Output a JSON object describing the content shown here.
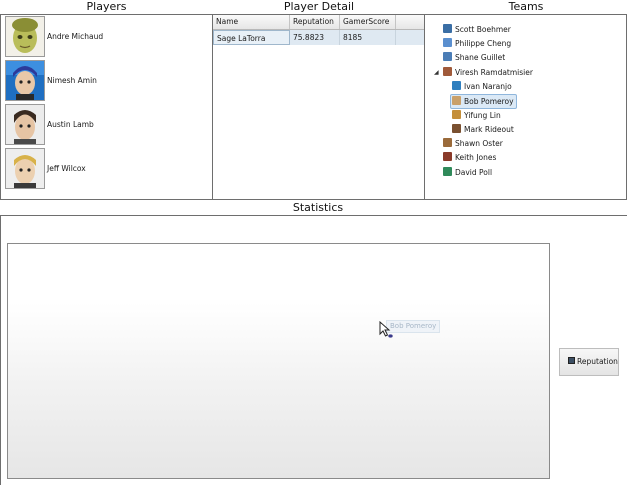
{
  "headers": {
    "players": "Players",
    "player_detail": "Player Detail",
    "teams": "Teams",
    "statistics": "Statistics"
  },
  "players": [
    {
      "name": "Andre Michaud",
      "avatar": "avatar-green-face"
    },
    {
      "name": "Nimesh Amin",
      "avatar": "avatar-blue-hair"
    },
    {
      "name": "Austin Lamb",
      "avatar": "avatar-dark-hair"
    },
    {
      "name": "Jeff Wilcox",
      "avatar": "avatar-blond-hair"
    }
  ],
  "player_detail": {
    "columns": [
      "Name",
      "Reputation",
      "GamerScore"
    ],
    "rows": [
      {
        "name": "Sage LaTorra",
        "reputation": "75.8823",
        "gamerscore": "8185"
      }
    ]
  },
  "teams": [
    {
      "name": "Scott Boehmer",
      "level": 0
    },
    {
      "name": "Philippe Cheng",
      "level": 0
    },
    {
      "name": "Shane Guillet",
      "level": 0
    },
    {
      "name": "Viresh Ramdatmisier",
      "level": 0,
      "expanded": true
    },
    {
      "name": "Ivan Naranjo",
      "level": 1
    },
    {
      "name": "Bob Pomeroy",
      "level": 1,
      "selected": true
    },
    {
      "name": "Yifung Lin",
      "level": 1
    },
    {
      "name": "Mark Rideout",
      "level": 1
    },
    {
      "name": "Shawn Oster",
      "level": 0
    },
    {
      "name": "Keith Jones",
      "level": 0
    },
    {
      "name": "David Poll",
      "level": 0
    }
  ],
  "statistics": {
    "legend_label": "Reputation",
    "drag_label": "Bob Pomeroy"
  },
  "chart_data": {
    "type": "bar",
    "categories": [],
    "series": [
      {
        "name": "Reputation",
        "values": []
      }
    ],
    "title": "Statistics",
    "legend": "right"
  },
  "colors": {
    "selection": "#dbe9f6",
    "legend_swatch": "#3b4e63"
  }
}
